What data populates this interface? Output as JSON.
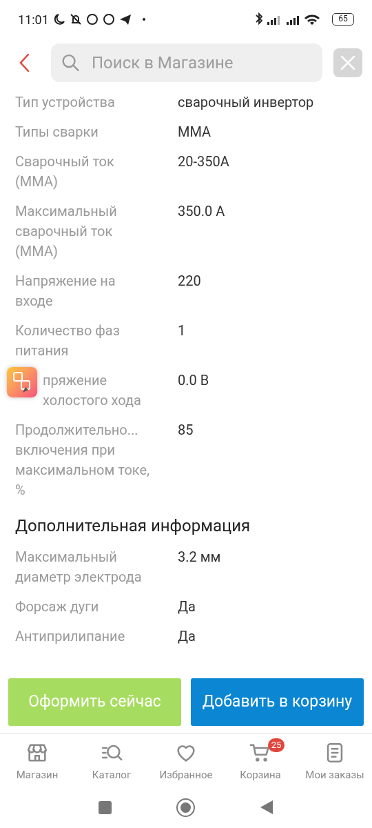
{
  "status_bar": {
    "time": "11:01",
    "battery": "65"
  },
  "search": {
    "placeholder": "Поиск в Магазине"
  },
  "specs": [
    {
      "label": "Тип устройства",
      "value": "сварочный инвертор"
    },
    {
      "label": "Типы сварки",
      "value": "MMA"
    },
    {
      "label": "Сварочный ток (MMA)",
      "value": "20-350A"
    },
    {
      "label": "Максимальный сварочный ток (MMA)",
      "value": "350.0 A"
    },
    {
      "label": "Напряжение на входе",
      "value": "220"
    },
    {
      "label": "Количество фаз питания",
      "value": "1"
    },
    {
      "label": "пряжение холостого хода",
      "value": "0.0 B",
      "covered": true
    },
    {
      "label": "Продолжительно... включения при максимальном токе, %",
      "value": "85"
    }
  ],
  "extra_section": {
    "title": "Дополнительная информация",
    "specs": [
      {
        "label": "Максимальный диаметр электрода",
        "value": "3.2 мм"
      },
      {
        "label": "Форсаж дуги",
        "value": "Да"
      },
      {
        "label": "Антиприлипание",
        "value": "Да"
      }
    ]
  },
  "actions": [
    {
      "kind": "buy",
      "label": "Оформить сейчас"
    },
    {
      "kind": "cart",
      "label": "Добавить в корзину"
    }
  ],
  "bottom_nav": [
    {
      "kind": "store",
      "label": "Магазин"
    },
    {
      "kind": "catalog",
      "label": "Каталог"
    },
    {
      "kind": "favorites",
      "label": "Избранное"
    },
    {
      "kind": "cart",
      "label": "Корзина",
      "badge": "25"
    },
    {
      "kind": "orders",
      "label": "Мои заказы"
    }
  ]
}
